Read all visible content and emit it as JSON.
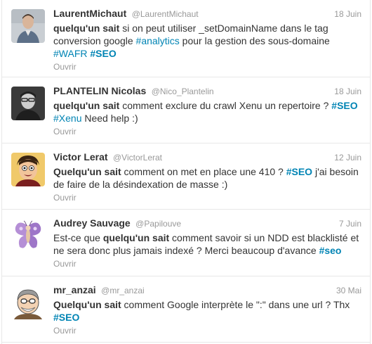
{
  "tweets": [
    {
      "fullname": "LaurentMichaut",
      "username": "@LaurentMichaut",
      "time": "18 Juin",
      "open": "Ouvrir",
      "avatar": "avatar-laurent-photo",
      "segments": [
        {
          "t": "bold",
          "v": "quelqu'un sait"
        },
        {
          "t": "text",
          "v": " si on peut utiliser _setDomainName dans le tag conversion google "
        },
        {
          "t": "link",
          "v": "#analytics"
        },
        {
          "t": "text",
          "v": " pour la gestion des sous-domaine "
        },
        {
          "t": "link",
          "v": "#WAFR"
        },
        {
          "t": "text",
          "v": " "
        },
        {
          "t": "strong-link",
          "v": "#SEO"
        }
      ]
    },
    {
      "fullname": "PLANTELIN Nicolas",
      "username": "@Nico_Plantelin",
      "time": "18 Juin",
      "open": "Ouvrir",
      "avatar": "avatar-nicolas-photo",
      "segments": [
        {
          "t": "bold",
          "v": "quelqu'un sait"
        },
        {
          "t": "text",
          "v": " comment exclure du crawl Xenu un repertoire ? "
        },
        {
          "t": "strong-link",
          "v": "#SEO"
        },
        {
          "t": "text",
          "v": " "
        },
        {
          "t": "link",
          "v": "#Xenu"
        },
        {
          "t": "text",
          "v": "  Need help :)"
        }
      ]
    },
    {
      "fullname": "Victor Lerat",
      "username": "@VictorLerat",
      "time": "12 Juin",
      "open": "Ouvrir",
      "avatar": "avatar-victor-cartoon",
      "segments": [
        {
          "t": "bold",
          "v": "Quelqu'un sait"
        },
        {
          "t": "text",
          "v": " comment on met en place une 410 ? "
        },
        {
          "t": "strong-link",
          "v": "#SEO"
        },
        {
          "t": "text",
          "v": " j'ai besoin de faire de la désindexation de masse :)"
        }
      ]
    },
    {
      "fullname": "Audrey Sauvage",
      "username": "@Papilouve",
      "time": "7 Juin",
      "open": "Ouvrir",
      "avatar": "avatar-audrey-butterfly",
      "segments": [
        {
          "t": "text",
          "v": "Est-ce que "
        },
        {
          "t": "bold",
          "v": "quelqu'un sait"
        },
        {
          "t": "text",
          "v": " comment savoir si un NDD est blacklisté et ne sera donc plus jamais indexé ? Merci beaucoup d'avance "
        },
        {
          "t": "strong-link",
          "v": "#seo"
        }
      ]
    },
    {
      "fullname": "mr_anzai",
      "username": "@mr_anzai",
      "time": "30 Mai",
      "open": "Ouvrir",
      "avatar": "avatar-anzai-cartoon",
      "segments": [
        {
          "t": "bold",
          "v": "Quelqu'un sait"
        },
        {
          "t": "text",
          "v": " comment Google interprète le \":\" dans une url ? Thx "
        },
        {
          "t": "strong-link",
          "v": "#SEO"
        }
      ]
    }
  ],
  "colors": {
    "link": "#0084b4",
    "text": "#333333",
    "meta": "#999999",
    "divider": "#e8e8e8"
  }
}
